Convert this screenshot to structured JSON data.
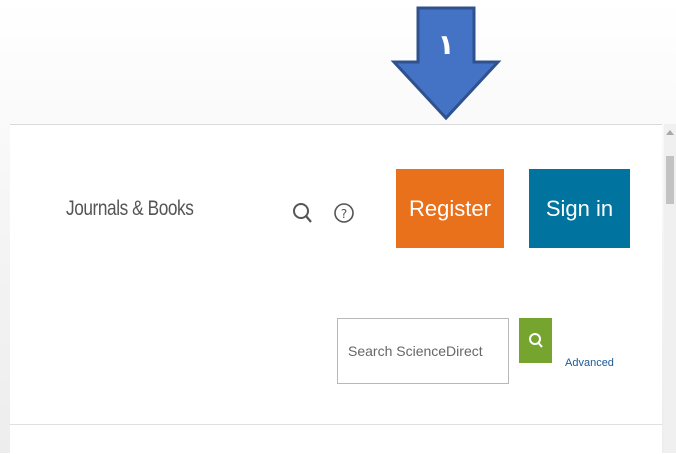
{
  "annotation": {
    "arrow_number": "١",
    "arrow_color": "#4472c4"
  },
  "header": {
    "journals_books": "Journals & Books",
    "icons": {
      "search": "search-icon",
      "help": "help-icon"
    },
    "register_label": "Register",
    "signin_label": "Sign in"
  },
  "search": {
    "placeholder": "Search ScienceDirect",
    "submit_icon": "search-icon",
    "advanced_label": "Advanced"
  },
  "colors": {
    "register": "#e9711c",
    "signin": "#00739e",
    "search_submit": "#76a52f",
    "advanced_link": "#1a5a96"
  }
}
